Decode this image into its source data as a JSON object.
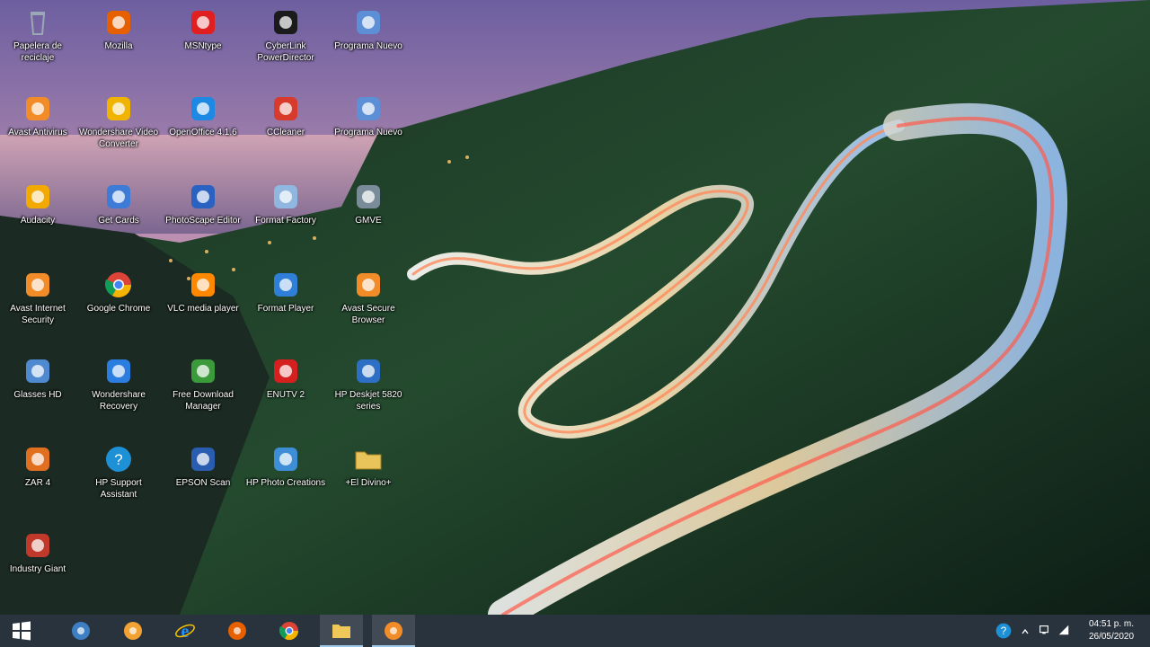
{
  "desktop": {
    "wallpaper": "night-coastal-winding-road-light-trails",
    "icons": [
      {
        "label": "Papelera de reciclaje",
        "icon": "recycle-bin-icon",
        "color": "#9aa7b5"
      },
      {
        "label": "Mozilla",
        "icon": "firefox-icon",
        "color": "#e66000"
      },
      {
        "label": "MSNtype",
        "icon": "app-icon",
        "color": "#e02020"
      },
      {
        "label": "CyberLink PowerDirector",
        "icon": "powerdirector-icon",
        "color": "#1b1b1b"
      },
      {
        "label": "Programa Nuevo",
        "icon": "app-icon",
        "color": "#5c8fd6"
      },
      {
        "label": "Avast Antivirus",
        "icon": "avast-icon",
        "color": "#f28c28"
      },
      {
        "label": "Wondershare Video Converter",
        "icon": "app-icon",
        "color": "#f0b400"
      },
      {
        "label": "OpenOffice 4.1.6",
        "icon": "openoffice-icon",
        "color": "#1e88e5"
      },
      {
        "label": "CCleaner",
        "icon": "ccleaner-icon",
        "color": "#d83b2b"
      },
      {
        "label": "Programa Nuevo",
        "icon": "app-icon",
        "color": "#5c8fd6"
      },
      {
        "label": "Audacity",
        "icon": "audacity-icon",
        "color": "#f2a900"
      },
      {
        "label": "Get Cards",
        "icon": "app-icon",
        "color": "#3d7bd6"
      },
      {
        "label": "PhotoScape Editor",
        "icon": "app-icon",
        "color": "#2a62c2"
      },
      {
        "label": "Format Factory",
        "icon": "formatfactory-icon",
        "color": "#8fb7e0"
      },
      {
        "label": "GMVE",
        "icon": "app-icon",
        "color": "#7a8c99"
      },
      {
        "label": "Avast Internet Security",
        "icon": "avast-icon",
        "color": "#f28c28"
      },
      {
        "label": "Google Chrome",
        "icon": "chrome-icon",
        "color": "#34a853"
      },
      {
        "label": "VLC media player",
        "icon": "vlc-icon",
        "color": "#ff8800"
      },
      {
        "label": "Format Player",
        "icon": "app-icon",
        "color": "#2f7fd8"
      },
      {
        "label": "Avast Secure Browser",
        "icon": "avast-browser-icon",
        "color": "#f28c28"
      },
      {
        "label": "Glasses HD",
        "icon": "app-icon",
        "color": "#4f8ad1"
      },
      {
        "label": "Wondershare Recovery",
        "icon": "app-icon",
        "color": "#2c7de0"
      },
      {
        "label": "Free Download Manager",
        "icon": "download-manager-icon",
        "color": "#3b9b3b"
      },
      {
        "label": "ENUTV 2",
        "icon": "app-icon",
        "color": "#d62020"
      },
      {
        "label": "HP Deskjet 5820 series",
        "icon": "printer-icon",
        "color": "#2d6fc4"
      },
      {
        "label": "ZAR 4",
        "icon": "app-icon",
        "color": "#e07020"
      },
      {
        "label": "HP Support Assistant",
        "icon": "help-icon",
        "color": "#1e90d6"
      },
      {
        "label": "EPSON Scan",
        "icon": "scanner-icon",
        "color": "#2a5db0"
      },
      {
        "label": "HP Photo Creations",
        "icon": "photo-icon",
        "color": "#3d8ed6"
      },
      {
        "label": "+El Divino+",
        "icon": "folder-icon",
        "color": "#e8c45a"
      },
      {
        "label": "Industry Giant",
        "icon": "game-icon",
        "color": "#c0392b"
      }
    ]
  },
  "taskbar": {
    "start_icon": "windows-start-icon",
    "buttons": [
      {
        "name": "taskbar-explorer-button",
        "icon": "computer-icon",
        "color": "#3e7fc4"
      },
      {
        "name": "taskbar-media-button",
        "icon": "disc-icon",
        "color": "#f2a233"
      },
      {
        "name": "taskbar-ie-button",
        "icon": "internet-explorer-icon",
        "color": "#1e90ff"
      },
      {
        "name": "taskbar-firefox-button",
        "icon": "firefox-icon",
        "color": "#e66000"
      },
      {
        "name": "taskbar-chrome-button",
        "icon": "chrome-icon",
        "color": "#34a853"
      },
      {
        "name": "taskbar-folder-button",
        "icon": "folder-icon",
        "color": "#f0c85a"
      },
      {
        "name": "taskbar-avast-button",
        "icon": "avast-icon",
        "color": "#f28c28"
      }
    ],
    "tray": {
      "time": "04:51 p. m.",
      "date": "26/05/2020"
    }
  }
}
